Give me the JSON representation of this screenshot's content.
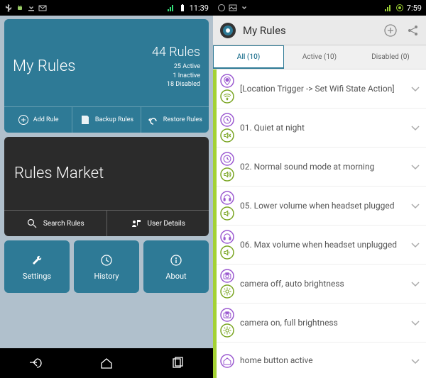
{
  "left": {
    "statusbar": {
      "time": "11:39"
    },
    "myrules": {
      "title": "My Rules",
      "count": "44 Rules",
      "active": "25 Active",
      "inactive": "1 Inactive",
      "disabled": "18 Disabled",
      "actions": {
        "add": "Add Rule",
        "backup": "Backup Rules",
        "restore": "Restore Rules"
      }
    },
    "market": {
      "title": "Rules Market",
      "actions": {
        "search": "Search Rules",
        "user": "User Details"
      }
    },
    "bottom": {
      "settings": "Settings",
      "history": "History",
      "about": "About"
    }
  },
  "right": {
    "statusbar": {
      "time": "7:59"
    },
    "header": {
      "title": "My Rules"
    },
    "tabs": {
      "all": "All (10)",
      "active": "Active (10)",
      "disabled": "Disabled (0)"
    },
    "rules": [
      {
        "label": "[Location Trigger -> Set Wifi State Action]",
        "ic1": "location",
        "ic2": "wifi"
      },
      {
        "label": "01. Quiet at night",
        "ic1": "clock",
        "ic2": "mute"
      },
      {
        "label": "02. Normal sound mode at morning",
        "ic1": "clock",
        "ic2": "sound"
      },
      {
        "label": "05. Lower volume when headset plugged",
        "ic1": "headset",
        "ic2": "volume"
      },
      {
        "label": "06. Max volume when headset unplugged",
        "ic1": "headset",
        "ic2": "volume"
      },
      {
        "label": "camera off, auto brightness",
        "ic1": "camera",
        "ic2": "brightness"
      },
      {
        "label": "camera on, full brightness",
        "ic1": "camera",
        "ic2": "brightness"
      },
      {
        "label": "home button active",
        "ic1": "home",
        "ic2": ""
      }
    ]
  },
  "colors": {
    "teal": "#2e7a96",
    "lime": "#a4d233",
    "purple": "#9b59d0"
  }
}
